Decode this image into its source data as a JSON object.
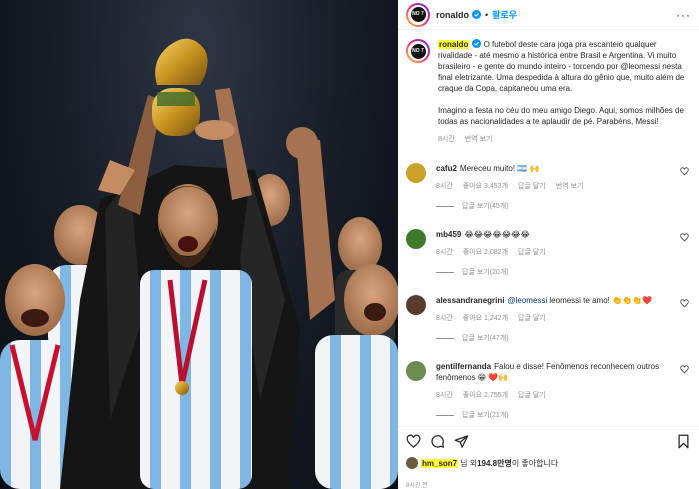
{
  "post": {
    "author": "ronaldo",
    "follow_label": "팔로우",
    "more_label": "···",
    "logo_text": "NO 7"
  },
  "caption": {
    "username": "ronaldo",
    "text_1": " O futebol deste cara joga pra escanteio qualquer rivalidade - até mesmo a histórica entre Brasil e Argentina. Vi muito brasileiro - e gente do mundo inteiro - torcendo por @leomessi nesta final eletrizante. Uma despedida à altura do gênio que, muito além de craque da Copa, capitaneou uma era.",
    "text_2": "Imagino a festa no céu do meu amigo Diego. Aqui, somos milhões de todas as nacionalidades a te aplaudir de pé. Parabéns, Messi!",
    "time": "8시간",
    "translate": "번역 보기"
  },
  "comments": [
    {
      "username": "cafu2",
      "text": "Mereceu muito! 🇦🇷 🙌",
      "time": "8시간",
      "likes": "좋아요 3,453개",
      "reply": "답글 달기",
      "translate": "번역 보기",
      "replies": "답글 보기(45개)",
      "avatar_color": "#c9a227"
    },
    {
      "username": "mb459",
      "text": "😂😂😂😂😂😂😂",
      "time": "8시간",
      "likes": "좋아요 2,082개",
      "reply": "답글 달기",
      "replies": "답글 보기(20개)",
      "avatar_color": "#3d7a2c"
    },
    {
      "username": "alessandranegrini",
      "mention": "@leomessi",
      "text": " leomessi te amo! 👏👏👏❤️",
      "time": "8시간",
      "likes": "좋아요 1,242개",
      "reply": "답글 달기",
      "replies": "답글 보기(47개)",
      "avatar_color": "#5a3b2e"
    },
    {
      "username": "gentilfernanda",
      "text": "Falou e disse! Fenômenos reconhecem outros fenômenos 😁 ❤️🙌",
      "time": "8시간",
      "likes": "좋아요 2,755개",
      "reply": "답글 달기",
      "replies": "답글 보기(21개)",
      "avatar_color": "#6c8b4f"
    }
  ],
  "likes": {
    "user": "hm_son7",
    "suffix_1": "님 외 ",
    "count": "194.8만명",
    "suffix_2": "이 좋아합니다"
  },
  "post_time": "8시간 전",
  "icons": {
    "like": "heart-icon",
    "comment": "comment-icon",
    "share": "send-icon",
    "save": "bookmark-icon"
  },
  "colors": {
    "accent": "#0095f6",
    "highlight": "#ffff33",
    "meta": "#8e8e8e"
  }
}
